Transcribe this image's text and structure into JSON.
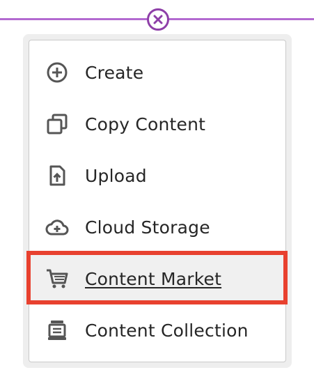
{
  "header": {
    "close_icon": "close-circle-icon",
    "line_color": "#b36ad0",
    "close_color": "#8e3fa8"
  },
  "menu": {
    "items": [
      {
        "label": "Create",
        "icon": "add-circle-icon"
      },
      {
        "label": "Copy Content",
        "icon": "copy-icon"
      },
      {
        "label": "Upload",
        "icon": "upload-file-icon"
      },
      {
        "label": "Cloud Storage",
        "icon": "cloud-add-icon"
      },
      {
        "label": "Content Market",
        "icon": "cart-icon",
        "active": true
      },
      {
        "label": "Content Collection",
        "icon": "collection-icon"
      }
    ],
    "highlight_color": "#e8412f"
  }
}
